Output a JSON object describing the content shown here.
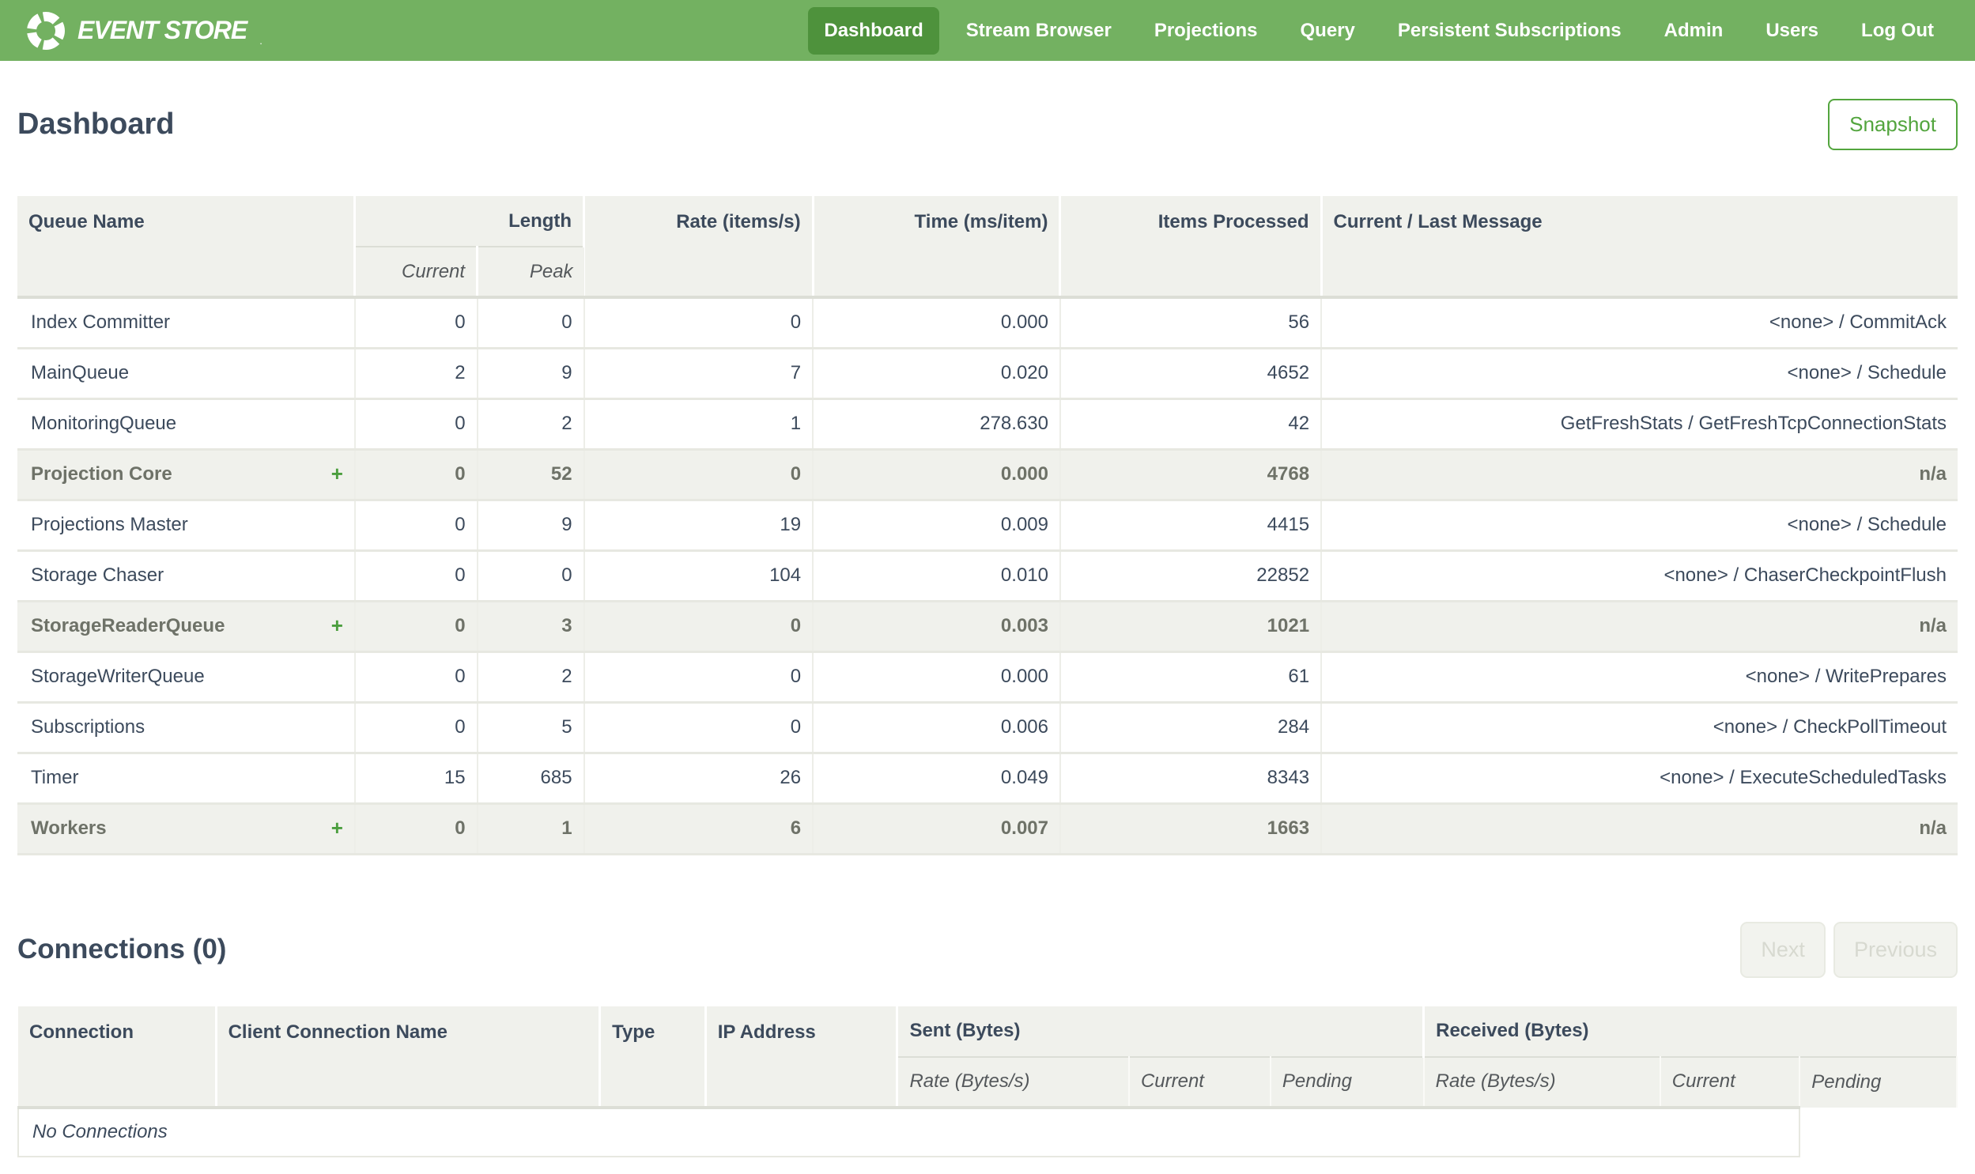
{
  "colors": {
    "nav_bg": "#73b161",
    "nav_active_bg": "#4e923c",
    "accent_green": "#4b9e3e",
    "snapshot_green": "#53a53e",
    "header_bg": "#f0f1ec",
    "group_row_bg": "#f0f1ec",
    "text_dark": "#3c4a5c",
    "text_gray": "#6e7268",
    "subheader_gray": "#54585b",
    "row_border": "#e7e8e1",
    "cell_border": "#edeee8",
    "header_sep": "#dcded6",
    "disabled_bg": "#f2f3ee",
    "disabled_text": "#d7d9d0",
    "disabled_border": "#e8eae2"
  },
  "nav": {
    "brand": "EVENT STORE",
    "brand_tm": ".",
    "items": [
      {
        "label": "Dashboard",
        "active": true
      },
      {
        "label": "Stream Browser",
        "active": false
      },
      {
        "label": "Projections",
        "active": false
      },
      {
        "label": "Query",
        "active": false
      },
      {
        "label": "Persistent Subscriptions",
        "active": false
      },
      {
        "label": "Admin",
        "active": false
      },
      {
        "label": "Users",
        "active": false
      },
      {
        "label": "Log Out",
        "active": false
      }
    ]
  },
  "page": {
    "title": "Dashboard",
    "snapshot_button": "Snapshot"
  },
  "queues": {
    "headers": {
      "queue_name": "Queue Name",
      "length": "Length",
      "current": "Current",
      "peak": "Peak",
      "rate": "Rate (items/s)",
      "time": "Time (ms/item)",
      "items_processed": "Items Processed",
      "message": "Current / Last Message"
    },
    "expand_icon": "+",
    "rows": [
      {
        "name": "Index Committer",
        "group": false,
        "current": "0",
        "peak": "0",
        "rate": "0",
        "time": "0.000",
        "items": "56",
        "message": "<none> / CommitAck"
      },
      {
        "name": "MainQueue",
        "group": false,
        "current": "2",
        "peak": "9",
        "rate": "7",
        "time": "0.020",
        "items": "4652",
        "message": "<none> / Schedule"
      },
      {
        "name": "MonitoringQueue",
        "group": false,
        "current": "0",
        "peak": "2",
        "rate": "1",
        "time": "278.630",
        "items": "42",
        "message": "GetFreshStats / GetFreshTcpConnectionStats"
      },
      {
        "name": "Projection Core",
        "group": true,
        "current": "0",
        "peak": "52",
        "rate": "0",
        "time": "0.000",
        "items": "4768",
        "message": "n/a"
      },
      {
        "name": "Projections Master",
        "group": false,
        "current": "0",
        "peak": "9",
        "rate": "19",
        "time": "0.009",
        "items": "4415",
        "message": "<none> / Schedule"
      },
      {
        "name": "Storage Chaser",
        "group": false,
        "current": "0",
        "peak": "0",
        "rate": "104",
        "time": "0.010",
        "items": "22852",
        "message": "<none> / ChaserCheckpointFlush"
      },
      {
        "name": "StorageReaderQueue",
        "group": true,
        "current": "0",
        "peak": "3",
        "rate": "0",
        "time": "0.003",
        "items": "1021",
        "message": "n/a"
      },
      {
        "name": "StorageWriterQueue",
        "group": false,
        "current": "0",
        "peak": "2",
        "rate": "0",
        "time": "0.000",
        "items": "61",
        "message": "<none> / WritePrepares"
      },
      {
        "name": "Subscriptions",
        "group": false,
        "current": "0",
        "peak": "5",
        "rate": "0",
        "time": "0.006",
        "items": "284",
        "message": "<none> / CheckPollTimeout"
      },
      {
        "name": "Timer",
        "group": false,
        "current": "15",
        "peak": "685",
        "rate": "26",
        "time": "0.049",
        "items": "8343",
        "message": "<none> / ExecuteScheduledTasks"
      },
      {
        "name": "Workers",
        "group": true,
        "current": "0",
        "peak": "1",
        "rate": "6",
        "time": "0.007",
        "items": "1663",
        "message": "n/a"
      }
    ]
  },
  "connections": {
    "title": "Connections (0)",
    "next_button": "Next",
    "previous_button": "Previous",
    "headers": {
      "connection": "Connection",
      "client_name": "Client Connection Name",
      "type": "Type",
      "ip": "IP Address",
      "sent": "Sent (Bytes)",
      "received": "Received (Bytes)",
      "rate": "Rate (Bytes/s)",
      "current": "Current",
      "pending": "Pending"
    },
    "empty_message": "No Connections"
  }
}
